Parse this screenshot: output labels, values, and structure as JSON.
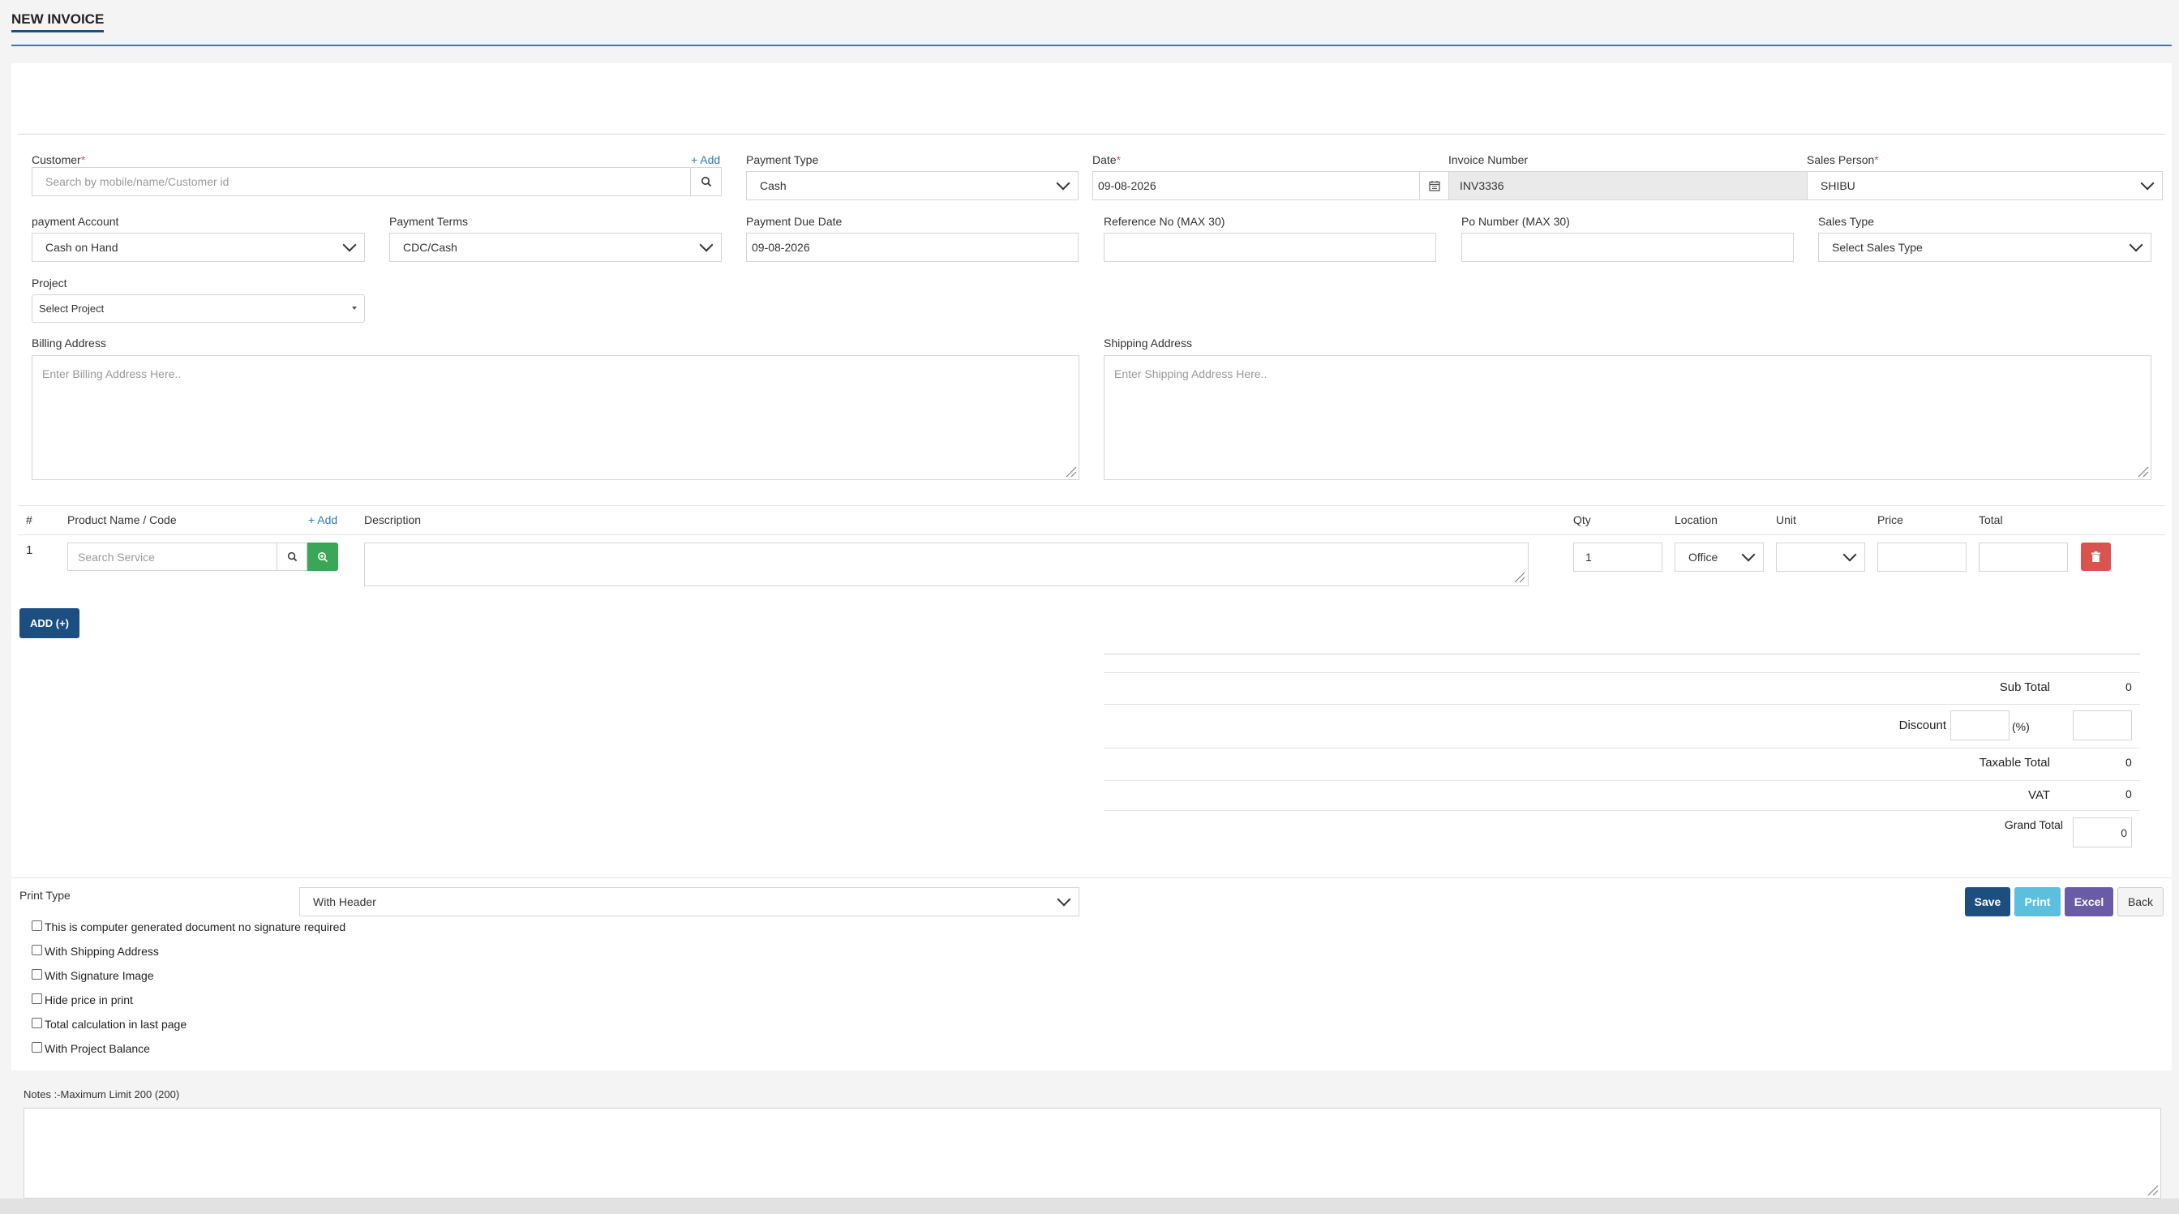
{
  "page": {
    "title": "NEW INVOICE"
  },
  "colors": {
    "primary": "#1c4e80",
    "info": "#5bc0de",
    "excel": "#6a5ba8",
    "danger": "#d9534f",
    "success": "#3aa657"
  },
  "customer": {
    "label": "Customer",
    "required": "*",
    "add_link": "+ Add",
    "placeholder": "Search by mobile/name/Customer id",
    "search_icon": "search-icon"
  },
  "payment_type": {
    "label": "Payment Type",
    "value": "Cash"
  },
  "date": {
    "label": "Date",
    "required": "*",
    "value": "09-08-2026",
    "icon": "calendar-icon"
  },
  "invoice_number": {
    "label": "Invoice Number",
    "value": "INV3336"
  },
  "sales_person": {
    "label": "Sales Person",
    "required": "*",
    "value": "SHIBU"
  },
  "payment_account": {
    "label": "payment Account",
    "value": "Cash on Hand"
  },
  "payment_terms": {
    "label": "Payment Terms",
    "value": "CDC/Cash"
  },
  "payment_due_date": {
    "label": "Payment Due Date",
    "value": "09-08-2026"
  },
  "reference_no": {
    "label": "Reference No (MAX 30)",
    "value": ""
  },
  "po_number": {
    "label": "Po Number (MAX 30)",
    "value": ""
  },
  "sales_type": {
    "label": "Sales Type",
    "value": "Select Sales Type"
  },
  "project": {
    "label": "Project",
    "value": "Select Project"
  },
  "billing_address": {
    "label": "Billing Address",
    "placeholder": "Enter Billing Address Here.."
  },
  "shipping_address": {
    "label": "Shipping Address",
    "placeholder": "Enter Shipping Address Here.."
  },
  "items_table": {
    "headers": {
      "num": "#",
      "product": "Product Name / Code",
      "add_link": "+ Add",
      "description": "Description",
      "qty": "Qty",
      "location": "Location",
      "unit": "Unit",
      "price": "Price",
      "total": "Total"
    },
    "rows": [
      {
        "num": "1",
        "product_placeholder": "Search Service",
        "description": "",
        "qty": "1",
        "location": "Office",
        "unit": "",
        "price": "",
        "total": ""
      }
    ],
    "add_button": "ADD (+)"
  },
  "totals": {
    "sub_total_label": "Sub Total",
    "sub_total": "0",
    "discount_label": "Discount",
    "discount_percent_suffix": "(%)",
    "discount_percent": "",
    "discount_amount": "",
    "taxable_total_label": "Taxable Total",
    "taxable_total": "0",
    "vat_label": "VAT",
    "vat": "0",
    "grand_total_label": "Grand Total",
    "grand_total": "0"
  },
  "print": {
    "label": "Print Type",
    "value": "With Header",
    "options": [
      {
        "label": "This is computer generated document no signature required",
        "checked": false
      },
      {
        "label": "With Shipping Address",
        "checked": false
      },
      {
        "label": "With Signature Image",
        "checked": false
      },
      {
        "label": "Hide price in print",
        "checked": false
      },
      {
        "label": "Total calculation in last page",
        "checked": false
      },
      {
        "label": "With Project Balance",
        "checked": false
      }
    ]
  },
  "actions": {
    "save": "Save",
    "print": "Print",
    "excel": "Excel",
    "back": "Back"
  },
  "notes": {
    "label": "Notes :-Maximum Limit 200 (200)",
    "value": ""
  }
}
